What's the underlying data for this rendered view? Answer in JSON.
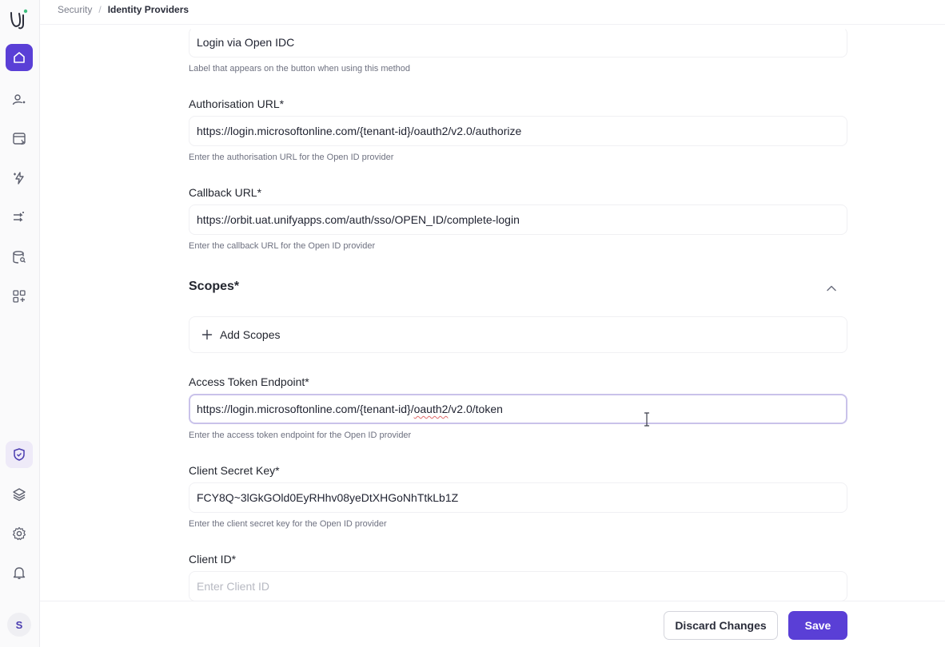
{
  "breadcrumb": {
    "parent": "Security",
    "separator": "/",
    "current": "Identity Providers"
  },
  "form": {
    "button_label": {
      "value": "Login via Open IDC",
      "hint": "Label that appears on the button when using this method"
    },
    "authorisation_url": {
      "label": "Authorisation URL*",
      "value": "https://login.microsoftonline.com/{tenant-id}/oauth2/v2.0/authorize",
      "hint": "Enter the authorisation URL for the Open ID provider"
    },
    "callback_url": {
      "label": "Callback URL*",
      "value": "https://orbit.uat.unifyapps.com/auth/sso/OPEN_ID/complete-login",
      "hint": "Enter the callback URL for the Open ID provider"
    },
    "scopes": {
      "title": "Scopes*",
      "add_label": "Add Scopes"
    },
    "access_token_endpoint": {
      "label": "Access Token Endpoint*",
      "value_prefix": "https://login.microsoftonline.com/{tenant-id}/",
      "value_misspelled": "oauth2",
      "value_suffix": "/v2.0/token",
      "hint": "Enter the access token endpoint for the Open ID provider"
    },
    "client_secret_key": {
      "label": "Client Secret Key*",
      "value": "FCY8Q~3lGkGOld0EyRHhv08yeDtXHGoNhTtkLb1Z",
      "hint": "Enter the client secret key for the Open ID provider"
    },
    "client_id": {
      "label": "Client ID*",
      "placeholder": "Enter Client ID"
    }
  },
  "footer": {
    "discard_label": "Discard Changes",
    "save_label": "Save"
  },
  "user": {
    "initial": "S"
  },
  "colors": {
    "accent": "#5a3fd6",
    "sidebar_bg": "#fafafb"
  }
}
